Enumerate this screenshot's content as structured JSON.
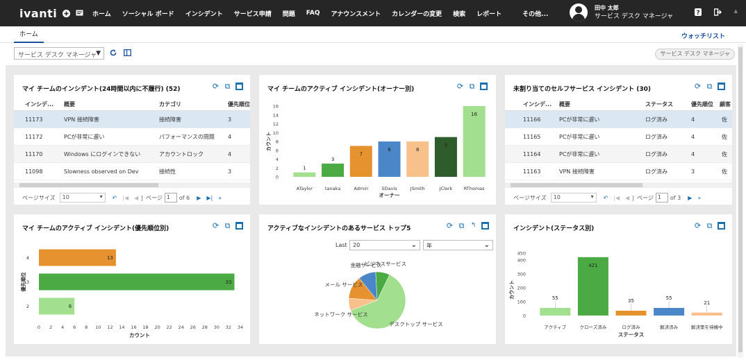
{
  "app": {
    "logo": "ivanti"
  },
  "nav": [
    "ホーム",
    "ソーシャル ボード",
    "インシデント",
    "サービス申請",
    "問題",
    "FAQ",
    "アナウンスメント",
    "カレンダーの変更",
    "検索",
    "レポート",
    "その他..."
  ],
  "user": {
    "name": "田中 太郎",
    "role": "サービス デスク マネージャ"
  },
  "tabs": {
    "home": "ホーム",
    "watchlist": "ウォッチリスト"
  },
  "toolbar": {
    "select": "サービス デスク マネージャ",
    "role_button": "サービス デスク マネージャ"
  },
  "panels": {
    "my_team_incidents": {
      "title": "マイ チームのインシデント(24時間以内に不履行) (52)",
      "columns": [
        "インシデ...",
        "概要",
        "カテゴリ",
        "優先順位"
      ],
      "rows": [
        [
          "11173",
          "VPN 接続障害",
          "接続障害",
          "3"
        ],
        [
          "11172",
          "PCが非常に遅い",
          "パフォーマンスの問題",
          "4"
        ],
        [
          "11170",
          "Windows にログインできない",
          "アカウントロック",
          "4"
        ],
        [
          "11098",
          "Slowness observed on Dev",
          "接続性",
          "3"
        ]
      ],
      "pager": {
        "label": "ページサイズ",
        "size": "10",
        "page_label": "ページ",
        "page": "1",
        "of": "of 6"
      }
    },
    "owner_chart": {
      "title": "マイ チームのアクティブ インシデント(オーナー別)"
    },
    "unassigned": {
      "title": "未割り当てのセルフサービス インシデント (30)",
      "columns": [
        "インシデ...",
        "概要",
        "ステータス",
        "優先順位",
        "顧客"
      ],
      "rows": [
        [
          "11166",
          "PCが非常に遅い",
          "ログ済み",
          "4",
          "佐"
        ],
        [
          "11165",
          "PCが非常に遅い",
          "ログ済み",
          "4",
          "佐"
        ],
        [
          "11164",
          "PCが非常に遅い",
          "ログ済み",
          "4",
          "佐"
        ],
        [
          "11163",
          "VPN 接続障害",
          "ログ済み",
          "3",
          "佐"
        ]
      ],
      "pager": {
        "label": "ページサイズ",
        "size": "10",
        "page_label": "ページ",
        "page": "1",
        "of": "of 3"
      }
    },
    "priority_chart": {
      "title": "マイ チームのアクティブ インシデント(優先順位別)"
    },
    "services_chart": {
      "title": "アクティブなインシデントのあるサービス トップ5",
      "last_label": "Last",
      "last_value": "20",
      "period": "年"
    },
    "status_chart": {
      "title": "インシデント(ステータス別)"
    }
  },
  "chart_data": [
    {
      "type": "bar",
      "title": "マイ チームのアクティブ インシデント(オーナー別)",
      "categories": [
        "ATaylor",
        "tanaka",
        "Admin",
        "SDavis",
        "JSmith",
        "JClerk",
        "RThomas"
      ],
      "values": [
        1,
        3,
        7,
        8,
        8,
        9,
        16
      ],
      "colors": [
        "#a2df8f",
        "#4caa44",
        "#e6922f",
        "#4a86c8",
        "#f8c08a",
        "#2e5c2a",
        "#a2df8f"
      ],
      "xlabel": "オーナー",
      "ylabel": "カウント",
      "ylim": [
        0,
        16
      ],
      "yticks": [
        0,
        2,
        4,
        6,
        8,
        10,
        12,
        14,
        16
      ]
    },
    {
      "type": "bar",
      "orientation": "horizontal",
      "title": "マイ チームのアクティブ インシデント(優先順位別)",
      "categories": [
        "4",
        "3",
        "2"
      ],
      "values": [
        13,
        33,
        6
      ],
      "colors": [
        "#e6922f",
        "#4caa44",
        "#a2df8f"
      ],
      "xlabel": "カウント",
      "ylabel": "優先順位",
      "xlim": [
        0,
        34
      ],
      "xticks": [
        0,
        2,
        4,
        6,
        8,
        10,
        12,
        14,
        16,
        18,
        20,
        22,
        24,
        26,
        28,
        30,
        32,
        34
      ]
    },
    {
      "type": "pie",
      "title": "アクティブなインシデントのあるサービス トップ5",
      "categories": [
        "デスクトップ サービス",
        "ネットワーク サービス",
        "メール サービス",
        "金融サービス",
        "ビジネスサービス"
      ],
      "values": [
        62,
        7,
        13,
        10,
        8
      ],
      "colors": [
        "#a2df8f",
        "#f8c08a",
        "#e6922f",
        "#4a86c8",
        "#4caa44"
      ]
    },
    {
      "type": "bar",
      "title": "インシデント(ステータス別)",
      "categories": [
        "アクティブ",
        "クローズ済み",
        "ログ済み",
        "解決済み",
        "解決策を待機中"
      ],
      "values": [
        55,
        421,
        35,
        55,
        21
      ],
      "colors": [
        "#a2df8f",
        "#4caa44",
        "#e6922f",
        "#4a86c8",
        "#f8c08a"
      ],
      "xlabel": "ステータス",
      "ylabel": "カウント",
      "ylim": [
        0,
        450
      ],
      "yticks": [
        0,
        100,
        200,
        300,
        400,
        450
      ]
    }
  ]
}
